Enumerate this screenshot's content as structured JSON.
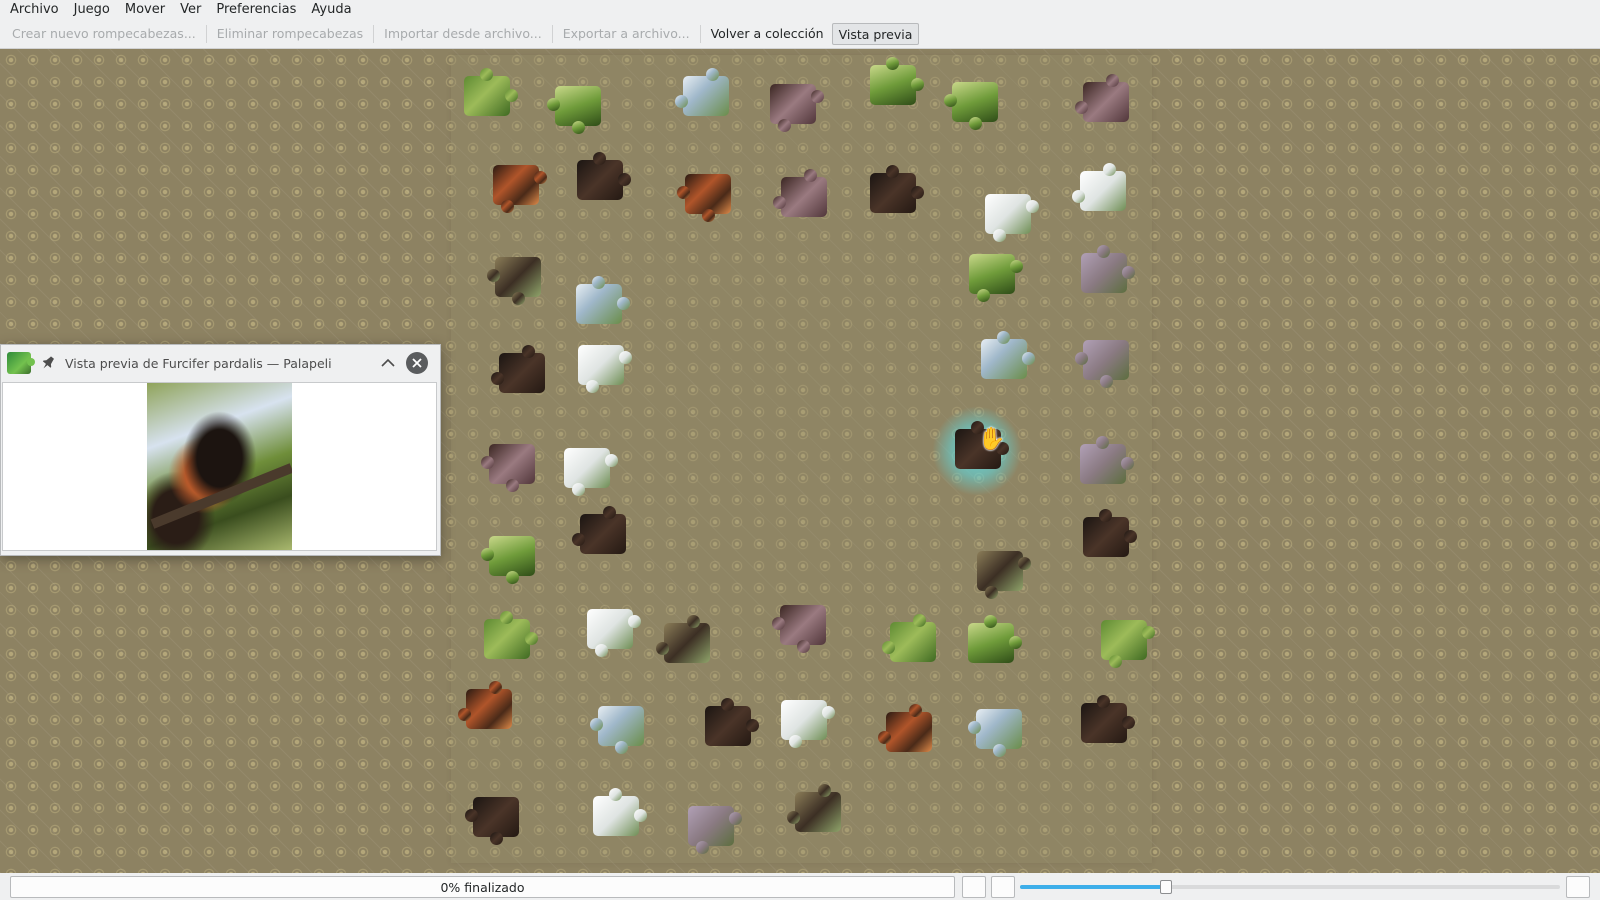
{
  "menubar": {
    "items": [
      {
        "label": "Archivo"
      },
      {
        "label": "Juego"
      },
      {
        "label": "Mover"
      },
      {
        "label": "Ver"
      },
      {
        "label": "Preferencias"
      },
      {
        "label": "Ayuda"
      }
    ]
  },
  "toolbar": {
    "create": "Crear nuevo rompecabezas...",
    "delete": "Eliminar rompecabezas",
    "import": "Importar desde archivo...",
    "export": "Exportar a archivo...",
    "back": "Volver a colección",
    "preview": "Vista previa"
  },
  "preview_window": {
    "title": "Vista previa de Furcifer pardalis — Palapeli",
    "icon": "palapeli-icon",
    "pin_icon": "pin-icon",
    "collapse_icon": "chevron-up-icon",
    "close_icon": "close-icon"
  },
  "statusbar": {
    "progress_text": "0% finalizado",
    "progress": 0,
    "zoom_level": 0.27
  },
  "colors": {
    "canvas": "#8d8262",
    "highlight": "#5ae1eb",
    "accent": "#3daee9"
  }
}
